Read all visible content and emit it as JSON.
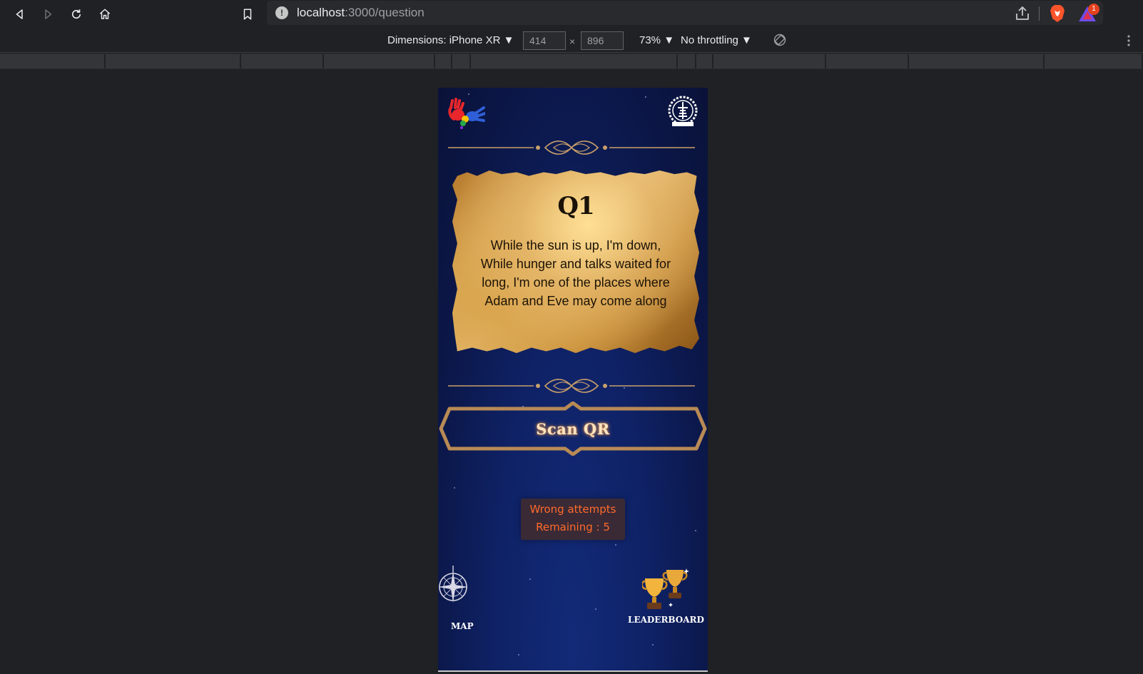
{
  "browser": {
    "url_host": "localhost",
    "url_path": ":3000/question",
    "rewards_badge": "1"
  },
  "devtools": {
    "dimensions_label": "Dimensions: iPhone XR ▼",
    "width_value": "414",
    "height_value": "896",
    "times": "×",
    "zoom": "73% ▼",
    "throttling": "No throttling ▼"
  },
  "page": {
    "question_title": "Q1",
    "question_text": "While the sun is up, I'm down, While hunger and talks waited for long, I'm one of the places where Adam and Eve may come along",
    "scan_label": "Scan QR",
    "attempts_line1": "Wrong attempts",
    "attempts_line2": "Remaining : 5",
    "map_label": "MAP",
    "leaderboard_label": "LEADERBOARD"
  },
  "colors": {
    "background": "#0b1748",
    "accent_gold": "#c9a06a",
    "attempts_text": "#ff6a2b"
  },
  "icons": [
    "back-icon",
    "forward-icon",
    "reload-icon",
    "home-icon",
    "bookmark-icon",
    "info-icon",
    "share-icon",
    "brave-lion-icon",
    "brave-rewards-icon",
    "rotate-icon",
    "kebab-icon",
    "hands-logo",
    "seal-logo",
    "compass-icon",
    "trophy-icon"
  ]
}
